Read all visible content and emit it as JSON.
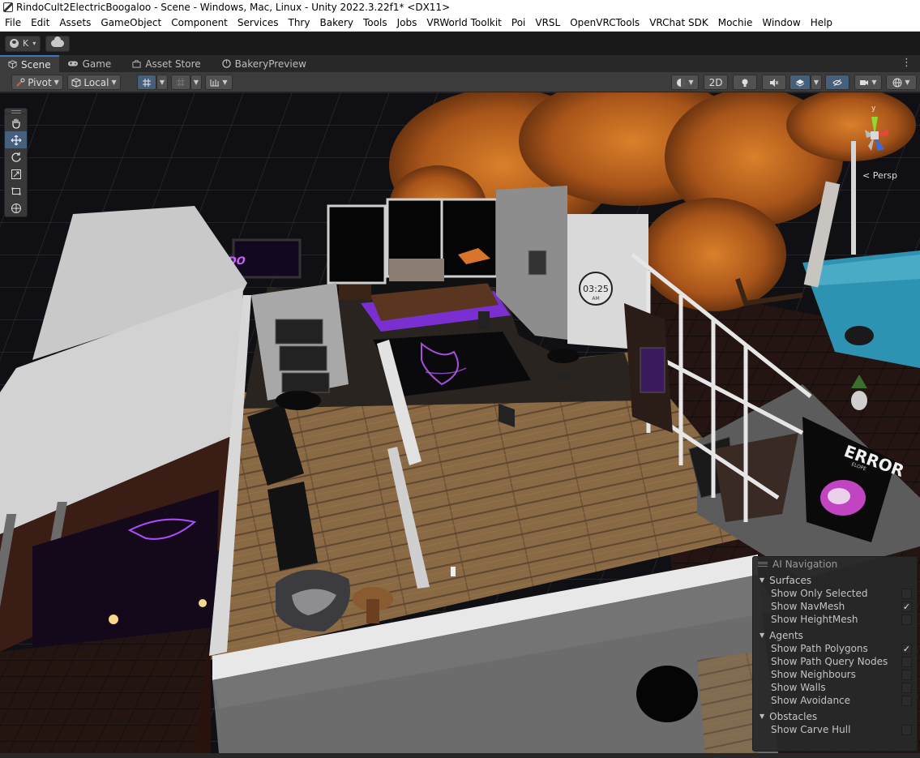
{
  "window": {
    "title": "RindoCult2ElectricBoogaloo - Scene - Windows, Mac, Linux - Unity 2022.3.22f1* <DX11>"
  },
  "menu": [
    "File",
    "Edit",
    "Assets",
    "GameObject",
    "Component",
    "Services",
    "Thry",
    "Bakery",
    "Tools",
    "Jobs",
    "VRWorld Toolkit",
    "Poi",
    "VRSL",
    "OpenVRCTools",
    "VRChat SDK",
    "Mochie",
    "Window",
    "Help"
  ],
  "account": {
    "initial": "K",
    "caret": "▾"
  },
  "tabs": [
    {
      "label": "Scene",
      "icon": "scene-icon",
      "active": true
    },
    {
      "label": "Game",
      "icon": "gamepad-icon",
      "active": false
    },
    {
      "label": "Asset Store",
      "icon": "store-icon",
      "active": false
    },
    {
      "label": "BakeryPreview",
      "icon": "bakery-icon",
      "active": false
    }
  ],
  "toolbar": {
    "pivot_label": "Pivot",
    "local_label": "Local",
    "mode_2d_label": "2D"
  },
  "tools": [
    "hand-tool-icon",
    "move-tool-icon",
    "rotate-tool-icon",
    "scale-tool-icon",
    "rect-tool-icon",
    "transform-tool-icon"
  ],
  "scene": {
    "clock_time": "03:25",
    "clock_ampm": "AM",
    "poster_text": "ERROR",
    "poster_subtext": "ELOPE",
    "sign_text": "#RINDO"
  },
  "gizmo": {
    "persp_label": "< Persp",
    "y_label": "y",
    "x_label": "x",
    "z_label": "z"
  },
  "ai_navigation": {
    "title": "AI Navigation",
    "sections": [
      {
        "name": "Surfaces",
        "items": [
          {
            "label": "Show Only Selected",
            "checked": false
          },
          {
            "label": "Show NavMesh",
            "checked": true
          },
          {
            "label": "Show HeightMesh",
            "checked": false
          }
        ]
      },
      {
        "name": "Agents",
        "items": [
          {
            "label": "Show Path Polygons",
            "checked": true
          },
          {
            "label": "Show Path Query Nodes",
            "checked": false
          },
          {
            "label": "Show Neighbours",
            "checked": false
          },
          {
            "label": "Show Walls",
            "checked": false
          },
          {
            "label": "Show Avoidance",
            "checked": false
          }
        ]
      },
      {
        "name": "Obstacles",
        "items": [
          {
            "label": "Show Carve Hull",
            "checked": false
          }
        ]
      }
    ]
  },
  "colors": {
    "accent": "#3a79bb",
    "neon": "#b040ff",
    "pool": "#3aa6c4",
    "foliage": "#c9691b"
  }
}
